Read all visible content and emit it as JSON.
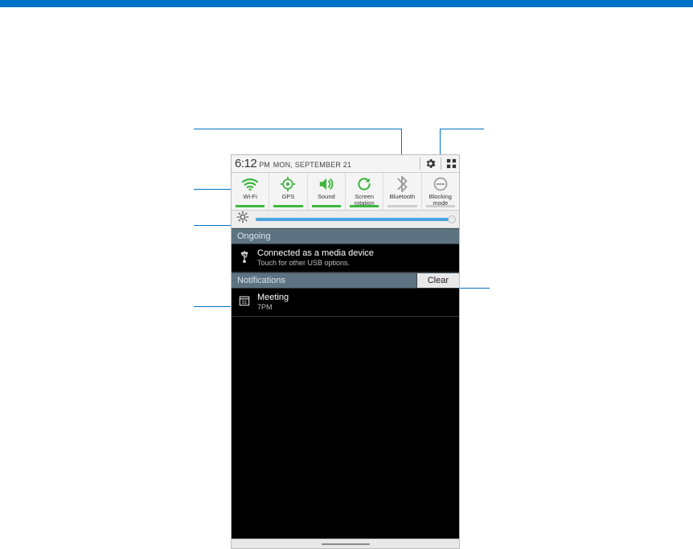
{
  "statusBar": {
    "time": "6:12",
    "ampm": "PM",
    "date": "MON, SEPTEMBER 21"
  },
  "quickSettings": [
    {
      "label": "Wi-Fi",
      "icon": "wifi",
      "active": true
    },
    {
      "label": "GPS",
      "icon": "gps",
      "active": true
    },
    {
      "label": "Sound",
      "icon": "sound",
      "active": true
    },
    {
      "label": "Screen\nrotation",
      "icon": "rotation",
      "active": true
    },
    {
      "label": "Bluetooth",
      "icon": "bluetooth",
      "active": false
    },
    {
      "label": "Blocking\nmode",
      "icon": "blocking",
      "active": false
    }
  ],
  "sections": {
    "ongoing": "Ongoing",
    "notifications": "Notifications",
    "clear": "Clear"
  },
  "ongoingItems": [
    {
      "title": "Connected as a media device",
      "subtitle": "Touch for other USB options.",
      "icon": "usb"
    }
  ],
  "notificationItems": [
    {
      "title": "Meeting",
      "subtitle": "7PM",
      "icon": "calendar"
    }
  ]
}
